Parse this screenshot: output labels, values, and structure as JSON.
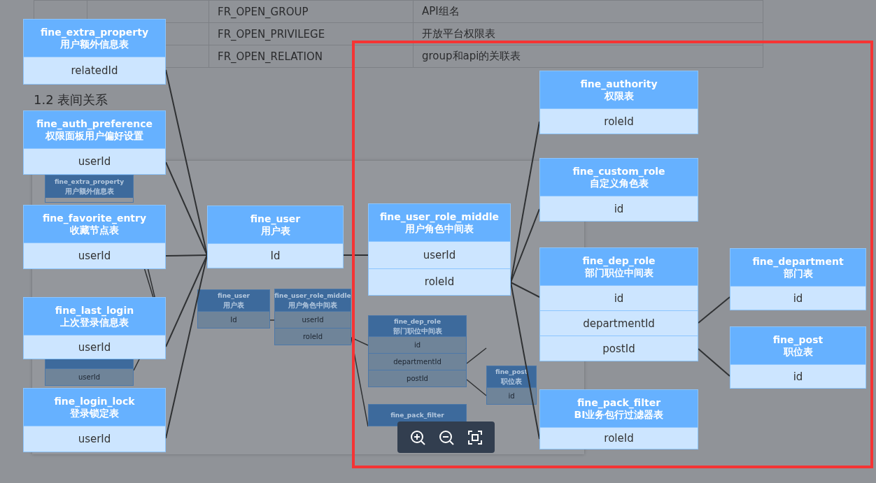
{
  "doc_table": {
    "rows": [
      {
        "column_3": "FR_OPEN_GROUP",
        "column_4": "API组名"
      },
      {
        "column_3": "FR_OPEN_PRIVILEGE",
        "column_4": "开放平台权限表"
      },
      {
        "column_3": "FR_OPEN_RELATION",
        "column_4": "group和api的关联表"
      }
    ]
  },
  "heading": "1.2 表间关系",
  "thumbnail": {
    "nodes": [
      {
        "title": "fine_extra_property",
        "caption": "用户额外信息表"
      },
      {
        "fields": [
          "userId"
        ]
      },
      {
        "title": "fine_user",
        "caption": "用户表",
        "fields": [
          "Id"
        ]
      },
      {
        "title": "fine_user_role_middle",
        "caption": "用户角色中间表",
        "fields": [
          "userId",
          "roleId"
        ]
      },
      {
        "title": "fine_dep_role",
        "caption": "部门职位中间表",
        "fields": [
          "id",
          "departmentId",
          "postId"
        ]
      },
      {
        "title": "fine_post",
        "caption": "职位表",
        "fields": [
          "id"
        ]
      },
      {
        "title": "fine_pack_filter"
      }
    ]
  },
  "diagram": {
    "nodes": [
      {
        "title": "fine_extra_property",
        "caption": "用户额外信息表",
        "fields": [
          "relatedId"
        ]
      },
      {
        "title": "fine_auth_preference",
        "caption": "权限面板用户偏好设置",
        "fields": [
          "userId"
        ]
      },
      {
        "title": "fine_favorite_entry",
        "caption": "收藏节点表",
        "fields": [
          "userId"
        ]
      },
      {
        "title": "fine_last_login",
        "caption": "上次登录信息表",
        "fields": [
          "userId"
        ]
      },
      {
        "title": "fine_login_lock",
        "caption": "登录锁定表",
        "fields": [
          "userId"
        ]
      },
      {
        "title": "fine_user",
        "caption": "用户表",
        "fields": [
          "Id"
        ]
      },
      {
        "title": "fine_user_role_middle",
        "caption": "用户角色中间表",
        "fields": [
          "userId",
          "roleId"
        ]
      },
      {
        "title": "fine_authority",
        "caption": "权限表",
        "fields": [
          "roleId"
        ]
      },
      {
        "title": "fine_custom_role",
        "caption": "自定义角色表",
        "fields": [
          "id"
        ]
      },
      {
        "title": "fine_dep_role",
        "caption": "部门职位中间表",
        "fields": [
          "id",
          "departmentId",
          "postId"
        ]
      },
      {
        "title": "fine_department",
        "caption": "部门表",
        "fields": [
          "id"
        ]
      },
      {
        "title": "fine_post",
        "caption": "职位表",
        "fields": [
          "id"
        ]
      },
      {
        "title": "fine_pack_filter",
        "caption": "BI业务包行过滤器表",
        "fields": [
          "roleId"
        ]
      }
    ]
  }
}
